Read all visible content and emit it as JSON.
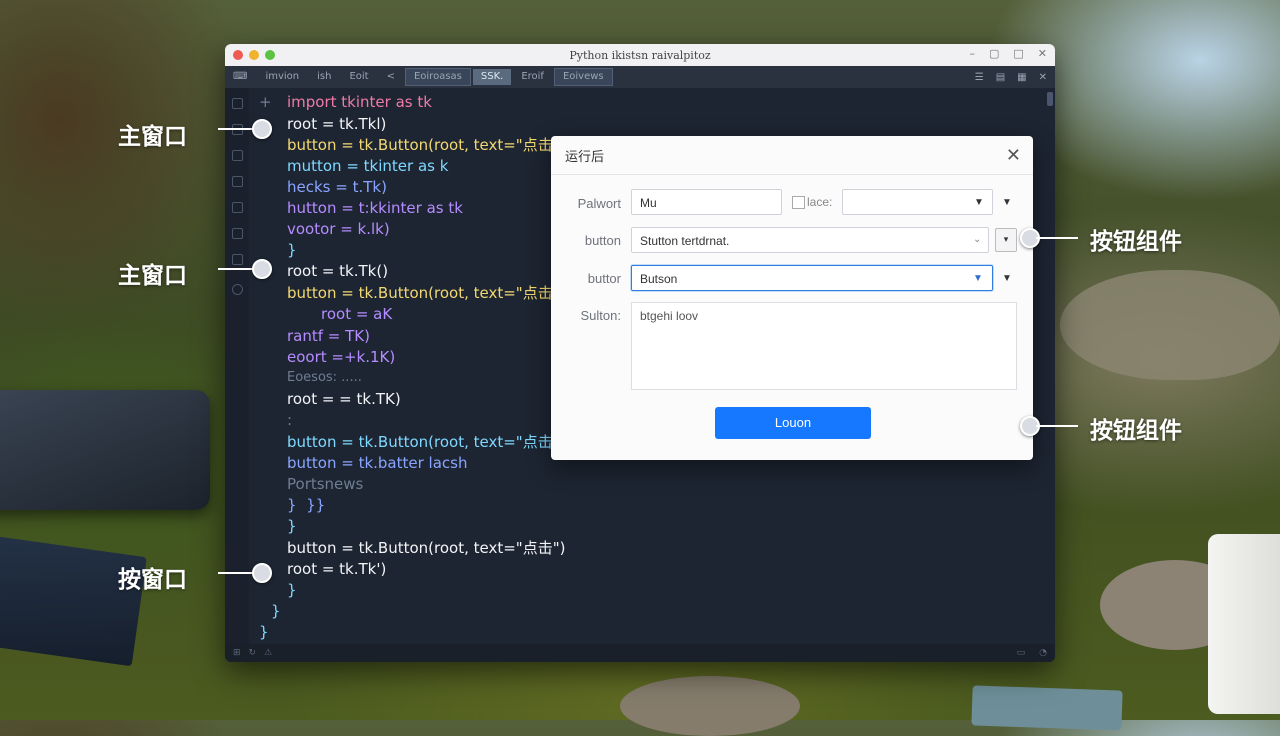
{
  "ide": {
    "window_title": "Python ikistsn raivalpitoz",
    "tabs": [
      {
        "label": "imvion"
      },
      {
        "label": "ish"
      },
      {
        "label": "Eoit"
      },
      {
        "label": "<"
      },
      {
        "label": "Eoiroasas"
      },
      {
        "label": "SSK."
      },
      {
        "label": "Eroif"
      },
      {
        "label": "Eoivews"
      }
    ],
    "code_lines": [
      "import tkinter as tk",
      "root = tk.Tkl)",
      "button = tk.Button(root, text=\"点击\"",
      "mutton = tkinter as k",
      "hecks = t.Tk)",
      "hutton = t:kkinter as tk",
      "vootor = k.lk)",
      "}",
      "root = tk.Tk()",
      "button = tk.Button(root, text=\"点击\"",
      "root = aK",
      "rantf = TK)",
      "eoort =+k.1K)",
      "Eoesos: .....",
      "root = = tk.TK)",
      ":",
      "button = tk.Button(root, text=\"点击",
      "button = tk.batter lacsh",
      "Portsnews",
      "}  }}",
      "}",
      "button = tk.Button(root, text=\"点击\")",
      "root = tk.Tk')",
      "}",
      "}",
      "}"
    ],
    "gutter_plus": "+"
  },
  "dialog": {
    "title": "运行后",
    "close_label": "✕",
    "row1_label": "Palwort",
    "row1_value": "Mu",
    "row1_check_label": "lace:",
    "row2_label": "button",
    "row2_value": "Stutton tertdrnat.",
    "row3_label": "buttor",
    "row3_value": "Butson",
    "row4_label": "Sulton:",
    "row4_text": "btgehi loov",
    "action_label": "Louon"
  },
  "annotations": {
    "left1": "主窗口",
    "left2": "主窗口",
    "left3": "按窗口",
    "right1": "按钮组件",
    "right2": "按钮组件"
  },
  "colors": {
    "accent": "#1677ff",
    "editor_bg": "#1d2532",
    "keyword": "#f07aa6",
    "identifier": "#7fd8ff",
    "string": "#f2d872"
  }
}
